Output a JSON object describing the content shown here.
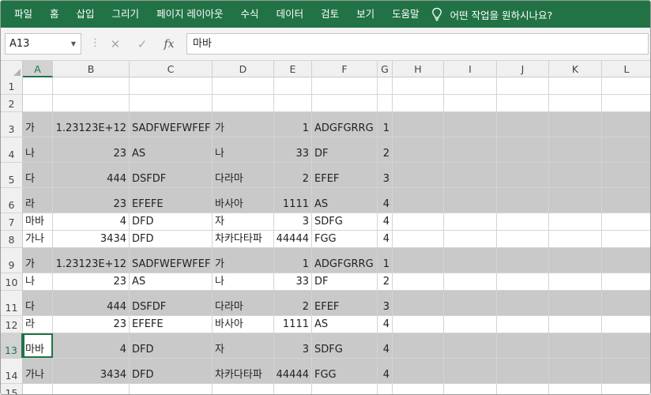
{
  "ribbon": {
    "tabs": [
      "파일",
      "홈",
      "삽입",
      "그리기",
      "페이지 레이아웃",
      "수식",
      "데이터",
      "검토",
      "보기",
      "도움말"
    ],
    "tell_me": "어떤 작업을 원하시나요?"
  },
  "formula_bar": {
    "name_box": "A13",
    "separator": "⋮",
    "cancel_icon": "✕",
    "enter_icon": "✓",
    "fx_label": "fx",
    "content": "마바"
  },
  "columns": [
    "A",
    "B",
    "C",
    "D",
    "E",
    "F",
    "G",
    "H",
    "I",
    "J",
    "K",
    "L"
  ],
  "selected_column": "A",
  "rows": [
    {
      "num": "1",
      "cells": [
        "",
        "",
        "",
        "",
        "",
        "",
        ""
      ]
    },
    {
      "num": "2",
      "cells": [
        "",
        "",
        "",
        "",
        "",
        "",
        ""
      ]
    },
    {
      "num": "3",
      "cells": [
        "가",
        "1.23123E+12",
        "SADFWEFWFEF",
        "가",
        "1",
        "ADGFGRRG",
        "1"
      ]
    },
    {
      "num": "4",
      "cells": [
        "나",
        "23",
        "AS",
        "나",
        "33",
        "DF",
        "2"
      ]
    },
    {
      "num": "5",
      "cells": [
        "다",
        "444",
        "DSFDF",
        "다라마",
        "2",
        "EFEF",
        "3"
      ]
    },
    {
      "num": "6",
      "cells": [
        "라",
        "23",
        "EFEFE",
        "바사아",
        "1111",
        "AS",
        "4"
      ]
    },
    {
      "num": "7",
      "cells": [
        "마바",
        "4",
        "DFD",
        "자",
        "3",
        "SDFG",
        "4"
      ]
    },
    {
      "num": "8",
      "cells": [
        "가나",
        "3434",
        "DFD",
        "차카다타파",
        "44444",
        "FGG",
        "4"
      ]
    },
    {
      "num": "9",
      "cells": [
        "가",
        "1.23123E+12",
        "SADFWEFWFEF",
        "가",
        "1",
        "ADGFGRRG",
        "1"
      ]
    },
    {
      "num": "10",
      "cells": [
        "나",
        "23",
        "AS",
        "나",
        "33",
        "DF",
        "2"
      ]
    },
    {
      "num": "11",
      "cells": [
        "다",
        "444",
        "DSFDF",
        "다라마",
        "2",
        "EFEF",
        "3"
      ]
    },
    {
      "num": "12",
      "cells": [
        "라",
        "23",
        "EFEFE",
        "바사아",
        "1111",
        "AS",
        "4"
      ]
    },
    {
      "num": "13",
      "cells": [
        "마바",
        "4",
        "DFD",
        "자",
        "3",
        "SDFG",
        "4"
      ]
    },
    {
      "num": "14",
      "cells": [
        "가나",
        "3434",
        "DFD",
        "차카다타파",
        "44444",
        "FGG",
        "4"
      ]
    },
    {
      "num": "15",
      "cells": [
        "",
        "",
        "",
        "",
        "",
        "",
        ""
      ]
    }
  ],
  "active_cell": "A13",
  "colors": {
    "accent": "#217346",
    "shaded_row": "#c9c9c9"
  }
}
